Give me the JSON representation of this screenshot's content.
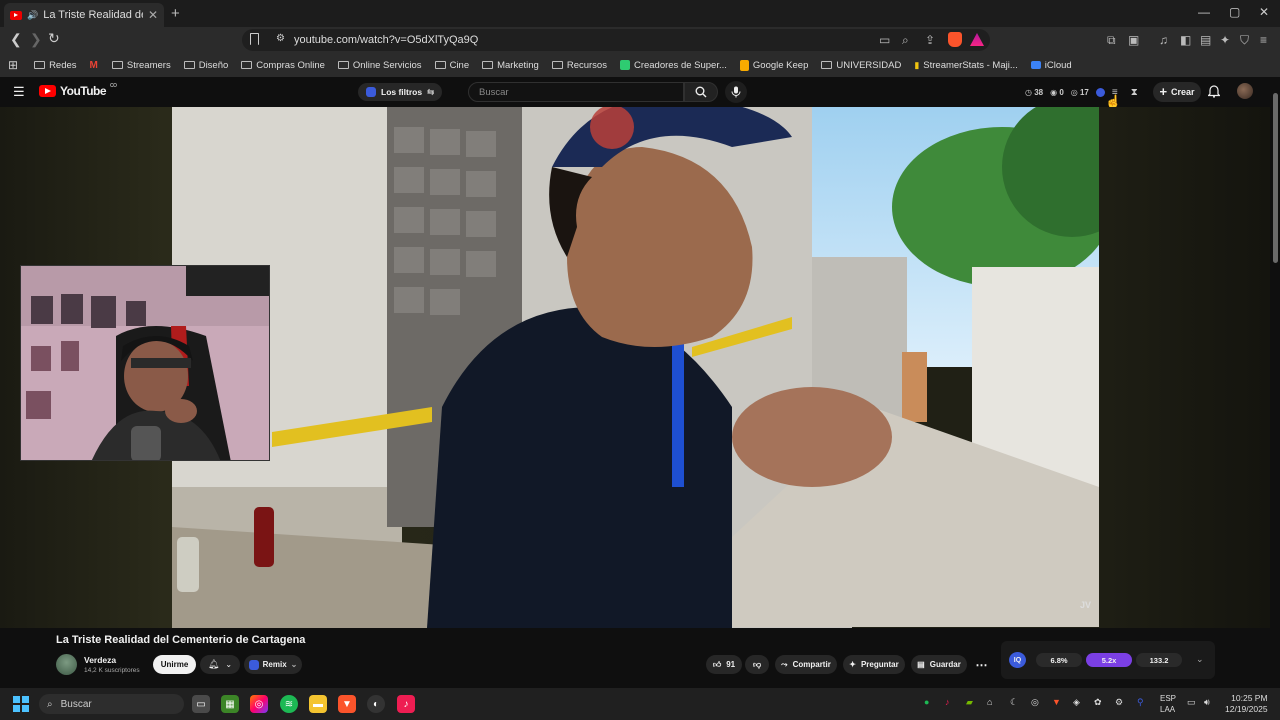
{
  "browser": {
    "tab_title": "La Triste Realidad del Cementerio de Cartagena",
    "tab_close": "✕",
    "new_tab": "+",
    "url": "youtube.com/watch?v=O5dXlTyQa9Q",
    "window_controls": [
      "—",
      "▢",
      "✕"
    ]
  },
  "bookmarks": [
    {
      "label": "Redes",
      "icon": "folder-icon"
    },
    {
      "label": "",
      "icon": "gmail-icon"
    },
    {
      "label": "Streamers",
      "icon": "folder-icon"
    },
    {
      "label": "Diseño",
      "icon": "folder-icon"
    },
    {
      "label": "Compras Online",
      "icon": "folder-icon"
    },
    {
      "label": "Online Servicios",
      "icon": "folder-icon"
    },
    {
      "label": "Cine",
      "icon": "folder-icon"
    },
    {
      "label": "Marketing",
      "icon": "folder-icon"
    },
    {
      "label": "Recursos",
      "icon": "folder-icon"
    },
    {
      "label": "Creadores de Super...",
      "icon": "green-icon"
    },
    {
      "label": "Google Keep",
      "icon": "keep-icon"
    },
    {
      "label": "UNIVERSIDAD",
      "icon": "folder-icon"
    },
    {
      "label": "StreamerStats - Maji...",
      "icon": "stats-icon"
    },
    {
      "label": "iCloud",
      "icon": "icloud-icon"
    }
  ],
  "youtube": {
    "logo_text": "YouTube",
    "logo_sup": "CO",
    "filters_label": "Los filtros",
    "search_placeholder": "Buscar",
    "stats": {
      "views": "38",
      "eye": "0",
      "likes": "17"
    },
    "create_label": "Crear"
  },
  "video": {
    "title": "La Triste Realidad del Cementerio de Cartagena",
    "channel": "Verdeza",
    "subscribers": "14,2 K suscriptores",
    "join_label": "Unirme",
    "remix_label": "Remix",
    "like_count": "91",
    "share_label": "Compartir",
    "ask_label": "Preguntar",
    "save_label": "Guardar",
    "watermark": "JV"
  },
  "extension_bar": {
    "chip1": "6.8%",
    "chip2": "5.2x",
    "chip3": "133.2"
  },
  "taskbar": {
    "search_placeholder": "Buscar",
    "lang_line1": "ESP",
    "lang_line2": "LAA",
    "time": "10:25 PM",
    "date": "12/19/2025"
  }
}
